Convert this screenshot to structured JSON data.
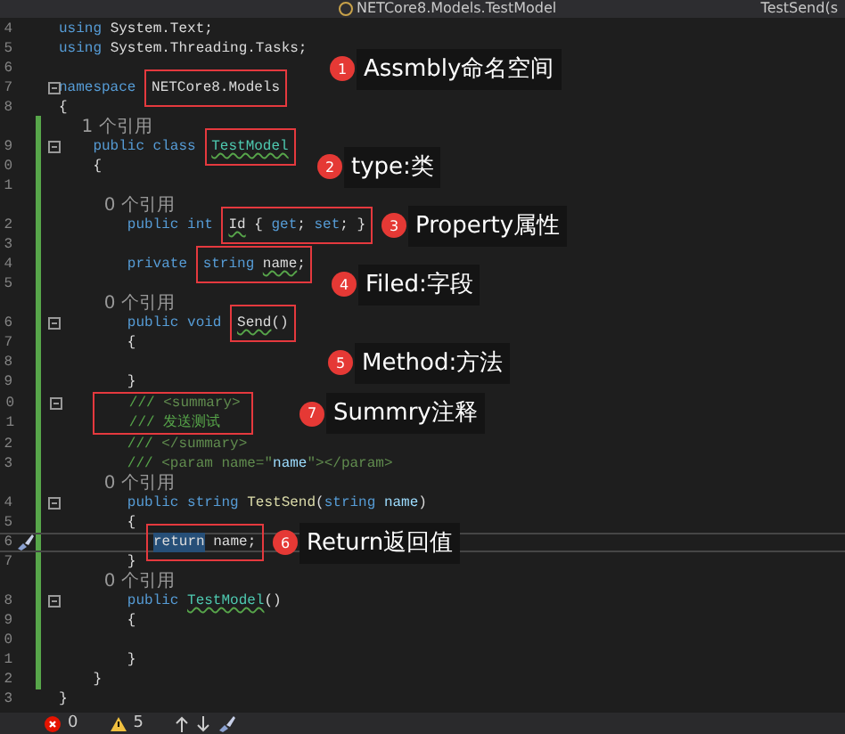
{
  "nav_bar": {
    "scope": "NETCore8.Models.TestModel",
    "member": "TestSend(s"
  },
  "lines": [
    {
      "kind": "code",
      "number": "4",
      "fold": false,
      "tokens": [
        {
          "text": "using",
          "kind": "kw"
        },
        {
          "text": " System.Text;",
          "kind": "t"
        }
      ]
    },
    {
      "kind": "code",
      "number": "5",
      "fold": false,
      "tokens": [
        {
          "text": "using",
          "kind": "kw"
        },
        {
          "text": " System.Threading.Tasks;",
          "kind": "t"
        }
      ]
    },
    {
      "kind": "code",
      "number": "6",
      "fold": false,
      "note": {
        "number": "1",
        "label": "Assmbly命名空间"
      }
    },
    {
      "kind": "code",
      "number": "7",
      "fold": true,
      "tokens": [
        {
          "text": "namespace ",
          "kind": "kw"
        },
        {
          "box": [
            {
              "text": "NETCore8.Models",
              "kind": "t"
            }
          ]
        }
      ]
    },
    {
      "kind": "code",
      "number": "8",
      "fold": false,
      "tokens": [
        {
          "text": "{",
          "kind": "t"
        }
      ]
    },
    {
      "kind": "lens",
      "text": "    1 个引用"
    },
    {
      "kind": "code",
      "number": "9",
      "fold": true,
      "tokens": [
        {
          "text": "    public class ",
          "kind": "kw"
        },
        {
          "box": [
            {
              "text": "TestModel",
              "kind": "sqtype"
            }
          ]
        }
      ]
    },
    {
      "kind": "code",
      "number": "0",
      "fold": false,
      "tokens": [
        {
          "text": "    {",
          "kind": "t"
        }
      ],
      "note": {
        "number": "2",
        "label": "type:类"
      }
    },
    {
      "kind": "code",
      "number": "1",
      "fold": false
    },
    {
      "kind": "lens",
      "text": "        0 个引用"
    },
    {
      "kind": "code",
      "number": "2",
      "fold": false,
      "tokens": [
        {
          "text": "        public int ",
          "kind": "kw"
        },
        {
          "box": [
            {
              "text": "Id",
              "kind": "sq"
            },
            {
              "text": " { ",
              "kind": "t"
            },
            {
              "text": "get",
              "kind": "kw"
            },
            {
              "text": "; ",
              "kind": "t"
            },
            {
              "text": "set",
              "kind": "kw"
            },
            {
              "text": "; }",
              "kind": "t"
            }
          ]
        }
      ],
      "note": {
        "number": "3",
        "label": "Property属性"
      }
    },
    {
      "kind": "code",
      "number": "3",
      "fold": false
    },
    {
      "kind": "code",
      "number": "4",
      "fold": false,
      "tokens": [
        {
          "text": "        private ",
          "kind": "kw"
        },
        {
          "box": [
            {
              "text": "string ",
              "kind": "kw"
            },
            {
              "text": "name",
              "kind": "sq"
            },
            {
              "text": ";",
              "kind": "t"
            }
          ]
        }
      ]
    },
    {
      "kind": "code",
      "number": "5",
      "fold": false,
      "note": {
        "number": "4",
        "label": "Filed:字段"
      }
    },
    {
      "kind": "lens",
      "text": "        0 个引用"
    },
    {
      "kind": "code",
      "number": "6",
      "fold": true,
      "tokens": [
        {
          "text": "        public void ",
          "kind": "kw"
        },
        {
          "box": [
            {
              "text": "Send",
              "kind": "sq"
            },
            {
              "text": "()",
              "kind": "t"
            }
          ]
        }
      ]
    },
    {
      "kind": "code",
      "number": "7",
      "fold": false,
      "tokens": [
        {
          "text": "        {",
          "kind": "t"
        }
      ]
    },
    {
      "kind": "code",
      "number": "8",
      "fold": false,
      "note": {
        "number": "5",
        "label": "Method:方法"
      }
    },
    {
      "kind": "code",
      "number": "9",
      "fold": false,
      "tokens": [
        {
          "text": "        }",
          "kind": "t"
        }
      ]
    },
    {
      "kind": "block",
      "note": {
        "number": "7",
        "label": "Summry注释"
      },
      "lines": [
        {
          "number": "0",
          "fold": true,
          "tokens": [
            {
              "text": "        /// ",
              "kind": "cm"
            },
            {
              "text": "<summary>",
              "kind": "doc"
            }
          ]
        },
        {
          "number": "1",
          "fold": false,
          "tokens": [
            {
              "text": "        /// 发送测试",
              "kind": "cm"
            }
          ]
        }
      ]
    },
    {
      "kind": "code",
      "number": "2",
      "fold": false,
      "tokens": [
        {
          "text": "        /// ",
          "kind": "cm"
        },
        {
          "text": "</summary>",
          "kind": "doc"
        }
      ]
    },
    {
      "kind": "code",
      "number": "3",
      "fold": false,
      "tokens": [
        {
          "text": "        /// ",
          "kind": "cm"
        },
        {
          "text": "<param name=\"",
          "kind": "doc"
        },
        {
          "text": "name",
          "kind": "param"
        },
        {
          "text": "\"></param>",
          "kind": "doc"
        }
      ]
    },
    {
      "kind": "lens",
      "text": "        0 个引用"
    },
    {
      "kind": "code",
      "number": "4",
      "fold": true,
      "tokens": [
        {
          "text": "        public string ",
          "kind": "kw"
        },
        {
          "text": "TestSend",
          "kind": "fn"
        },
        {
          "text": "(",
          "kind": "t"
        },
        {
          "text": "string ",
          "kind": "kw"
        },
        {
          "text": "name",
          "kind": "param"
        },
        {
          "text": ")",
          "kind": "t"
        }
      ]
    },
    {
      "kind": "code",
      "number": "5",
      "fold": false,
      "tokens": [
        {
          "text": "        {",
          "kind": "t"
        }
      ]
    },
    {
      "kind": "current",
      "number": "6",
      "fold": false,
      "tokens": [
        {
          "box": [
            {
              "text": "return",
              "kind": "sel"
            },
            {
              "text": " name;",
              "kind": "t"
            }
          ]
        }
      ],
      "note": {
        "number": "6",
        "label": "Return返回值"
      }
    },
    {
      "kind": "code",
      "number": "7",
      "fold": false,
      "tokens": [
        {
          "text": "        }",
          "kind": "t"
        }
      ]
    },
    {
      "kind": "lens",
      "text": "        0 个引用"
    },
    {
      "kind": "code",
      "number": "8",
      "fold": true,
      "tokens": [
        {
          "text": "        public ",
          "kind": "kw"
        },
        {
          "text": "TestModel",
          "kind": "sqtype"
        },
        {
          "text": "()",
          "kind": "t"
        }
      ]
    },
    {
      "kind": "code",
      "number": "9",
      "fold": false,
      "tokens": [
        {
          "text": "        {",
          "kind": "t"
        }
      ]
    },
    {
      "kind": "code",
      "number": "0",
      "fold": false
    },
    {
      "kind": "code",
      "number": "1",
      "fold": false,
      "tokens": [
        {
          "text": "        }",
          "kind": "t"
        }
      ]
    },
    {
      "kind": "code",
      "number": "2",
      "fold": false,
      "tokens": [
        {
          "text": "    }",
          "kind": "t"
        }
      ]
    },
    {
      "kind": "code",
      "number": "3",
      "fold": false,
      "tokens": [
        {
          "text": "}",
          "kind": "t"
        }
      ]
    }
  ],
  "status_bar": {
    "errors": "0",
    "warnings": "5"
  }
}
